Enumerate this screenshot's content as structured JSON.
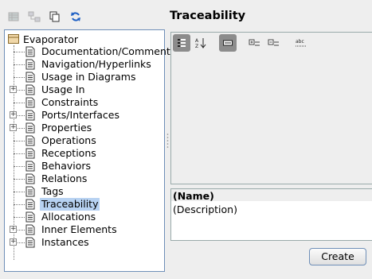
{
  "toolbar": {
    "icons": [
      "properties-icon",
      "hierarchy-icon",
      "copy-icon",
      "refresh-icon"
    ]
  },
  "tree": {
    "root_label": "Evaporator",
    "items": [
      {
        "label": "Documentation/Comments",
        "expandable": false,
        "selected": false
      },
      {
        "label": "Navigation/Hyperlinks",
        "expandable": false,
        "selected": false
      },
      {
        "label": "Usage in Diagrams",
        "expandable": false,
        "selected": false
      },
      {
        "label": "Usage In",
        "expandable": true,
        "selected": false
      },
      {
        "label": "Constraints",
        "expandable": false,
        "selected": false
      },
      {
        "label": "Ports/Interfaces",
        "expandable": true,
        "selected": false
      },
      {
        "label": "Properties",
        "expandable": true,
        "selected": false
      },
      {
        "label": "Operations",
        "expandable": false,
        "selected": false
      },
      {
        "label": "Receptions",
        "expandable": false,
        "selected": false
      },
      {
        "label": "Behaviors",
        "expandable": false,
        "selected": false
      },
      {
        "label": "Relations",
        "expandable": false,
        "selected": false
      },
      {
        "label": "Tags",
        "expandable": false,
        "selected": false
      },
      {
        "label": "Traceability",
        "expandable": false,
        "selected": true
      },
      {
        "label": "Allocations",
        "expandable": false,
        "selected": false
      },
      {
        "label": "Inner Elements",
        "expandable": true,
        "selected": false
      },
      {
        "label": "Instances",
        "expandable": true,
        "selected": false
      }
    ]
  },
  "panel": {
    "title": "Traceability",
    "toolbar_icons": [
      "categorized-view-icon",
      "sort-alphabetical-icon",
      "show-description-icon",
      "expand-all-icon",
      "collapse-all-icon",
      "spelling-icon"
    ]
  },
  "description": {
    "name": "(Name)",
    "text": "(Description)"
  },
  "buttons": {
    "create": "Create"
  },
  "colors": {
    "selection": "#b7d2f2",
    "border_accent": "#6f8fb8",
    "pressed_button": "#8c8c8c"
  }
}
